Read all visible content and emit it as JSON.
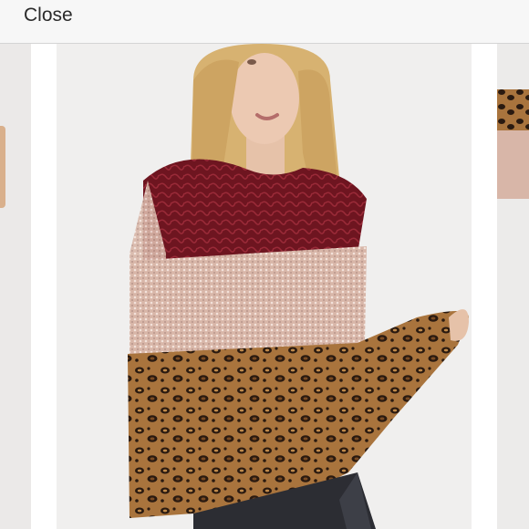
{
  "header": {
    "close_label": "Close"
  },
  "gallery": {
    "swatch_color": "#a31b1f",
    "colors": {
      "burgundy": "#6e1520",
      "sequin": "#d8b6a8",
      "leopard_base": "#a9743d"
    }
  }
}
